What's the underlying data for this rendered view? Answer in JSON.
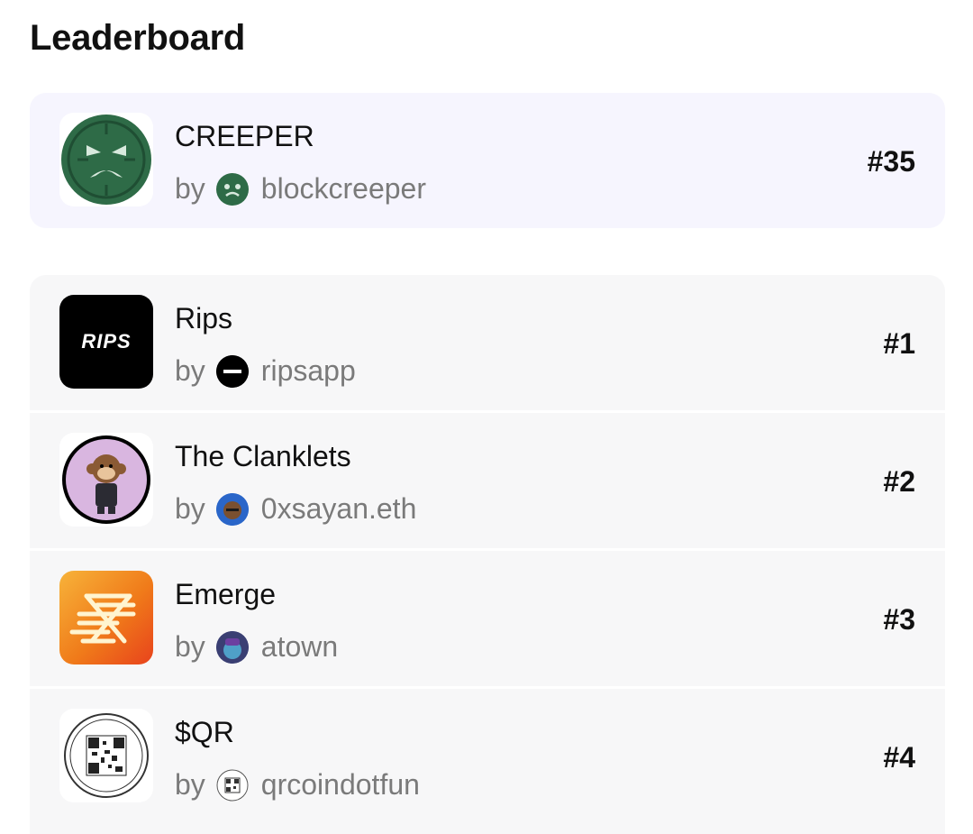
{
  "page": {
    "title": "Leaderboard"
  },
  "featured": {
    "name": "CREEPER",
    "by": "by",
    "author": "blockcreeper",
    "rank": "#35",
    "icon": "creeper-face-icon",
    "color": "#2e6b47"
  },
  "items": [
    {
      "name": "Rips",
      "by": "by",
      "author": "ripsapp",
      "rank": "#1",
      "icon": "rips-logo-icon",
      "color": "#000000",
      "logo_text": "RIPS"
    },
    {
      "name": "The Clanklets",
      "by": "by",
      "author": "0xsayan.eth",
      "rank": "#2",
      "icon": "monkey-avatar-icon",
      "color": "#d9b6e0"
    },
    {
      "name": "Emerge",
      "by": "by",
      "author": "atown",
      "rank": "#3",
      "icon": "emerge-logo-icon",
      "color": "#f07b1a"
    },
    {
      "name": "$QR",
      "by": "by",
      "author": "qrcoindotfun",
      "rank": "#4",
      "icon": "qr-coin-icon",
      "color": "#ffffff"
    }
  ]
}
